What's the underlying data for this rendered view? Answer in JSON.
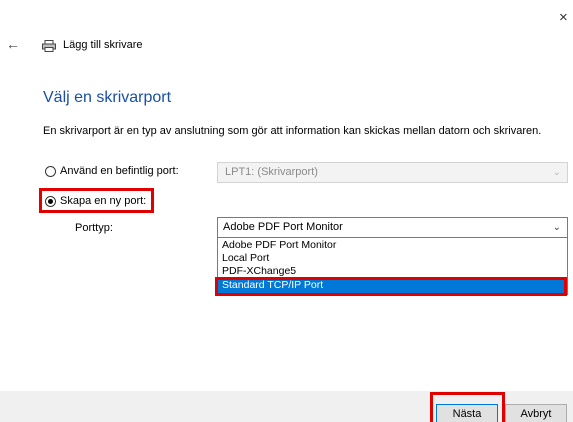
{
  "window": {
    "close_glyph": "×",
    "back_glyph": "←",
    "title": "Lägg till skrivare"
  },
  "main": {
    "heading": "Välj en skrivarport",
    "description": "En skrivarport är en typ av anslutning som gör att information kan skickas mellan datorn och skrivaren."
  },
  "options": {
    "use_existing": {
      "label": "Använd en befintlig port:",
      "selected": false,
      "value": "LPT1: (Skrivarport)"
    },
    "create_new": {
      "label": "Skapa en ny port:",
      "selected": true
    }
  },
  "port_type": {
    "label": "Porttyp:",
    "value": "Adobe PDF Port Monitor",
    "options": [
      "Adobe PDF Port Monitor",
      "Local Port",
      "PDF-XChange5",
      "Standard TCP/IP Port"
    ],
    "highlighted_index": 3
  },
  "footer": {
    "next_label": "Nästa",
    "cancel_label": "Avbryt"
  },
  "colors": {
    "heading": "#1b4fa3",
    "selection": "#0078d7",
    "annotation": "#e00000"
  },
  "icons": {
    "close": "close-icon",
    "back": "back-arrow-icon",
    "printer": "printer-icon",
    "dropdown": "chevron-down-icon"
  }
}
